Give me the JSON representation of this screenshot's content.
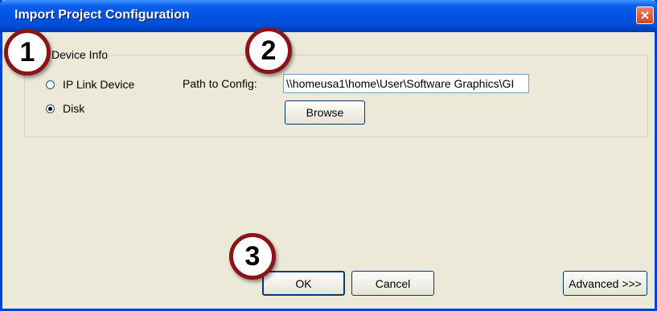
{
  "dialog": {
    "title": "Import Project Configuration",
    "close_icon": "close-icon"
  },
  "device_info": {
    "legend": "Device Info",
    "options": [
      {
        "label": "IP Link Device",
        "selected": false
      },
      {
        "label": "Disk",
        "selected": true
      }
    ],
    "path_label": "Path to Config:",
    "path_value": "\\\\homeusa1\\home\\User\\Software Graphics\\GI",
    "browse_label": "Browse"
  },
  "footer": {
    "ok_label": "OK",
    "cancel_label": "Cancel",
    "advanced_label": "Advanced >>>"
  },
  "callouts": [
    "1",
    "2",
    "3"
  ],
  "colors": {
    "titlebar": "#0054e3",
    "dialog_bg": "#ece9d8",
    "callout_ring": "#8a1418"
  }
}
